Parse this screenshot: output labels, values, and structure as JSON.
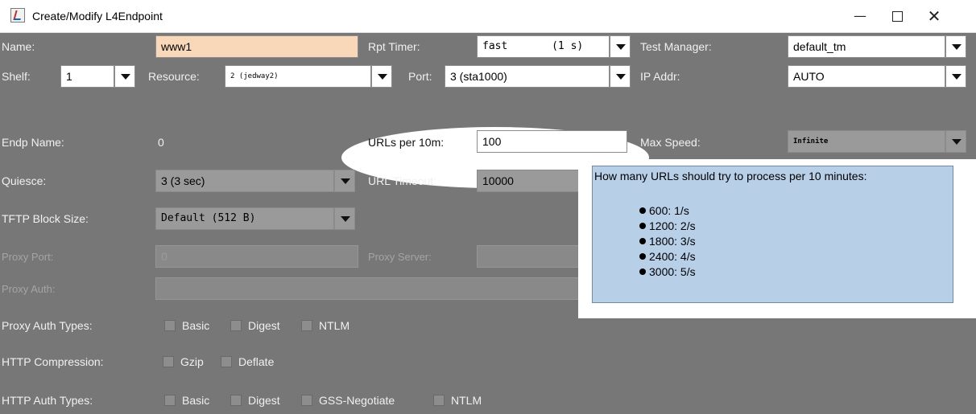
{
  "window": {
    "title": "Create/Modify L4Endpoint",
    "minimize": "—",
    "close": "✕"
  },
  "form": {
    "name": {
      "label": "Name:",
      "value": "www1"
    },
    "rpt_timer": {
      "label": "Rpt Timer:",
      "value": "fast       (1 s)"
    },
    "test_manager": {
      "label": "Test Manager:",
      "value": "default_tm"
    },
    "shelf": {
      "label": "Shelf:",
      "value": "1"
    },
    "resource": {
      "label": "Resource:",
      "value": "2 (jedway2)"
    },
    "port": {
      "label": "Port:",
      "value": "3 (sta1000)"
    },
    "ip_addr": {
      "label": "IP Addr:",
      "value": "AUTO"
    },
    "endp_name": {
      "label": "Endp Name:",
      "value": "0"
    },
    "urls_per_10m": {
      "label": "URLs per 10m:",
      "value": "100"
    },
    "max_speed": {
      "label": "Max Speed:",
      "value": "Infinite"
    },
    "quiesce": {
      "label": "Quiesce:",
      "value": "3 (3 sec)"
    },
    "url_timeout": {
      "label": "URL Timeout:",
      "value": "10000"
    },
    "tftp_block_size": {
      "label": "TFTP Block Size:",
      "value": "Default (512 B)"
    },
    "proxy_port": {
      "label": "Proxy Port:",
      "value": "0"
    },
    "proxy_server": {
      "label": "Proxy Server:",
      "value": ""
    },
    "proxy_auth": {
      "label": "Proxy Auth:",
      "value": ""
    },
    "proxy_auth_types": {
      "label": "Proxy Auth Types:",
      "options": [
        "Basic",
        "Digest",
        "NTLM"
      ]
    },
    "http_compression": {
      "label": "HTTP Compression:",
      "options": [
        "Gzip",
        "Deflate"
      ]
    },
    "http_auth_types": {
      "label": "HTTP Auth Types:",
      "options": [
        "Basic",
        "Digest",
        "GSS-Negotiate",
        "NTLM"
      ]
    }
  },
  "tooltip": {
    "title": "How many URLs should try to process per 10 minutes:",
    "items": [
      "600: 1/s",
      "1200: 2/s",
      "1800: 3/s",
      "2400: 4/s",
      "3000: 5/s"
    ]
  },
  "colors": {
    "overlay": "#777777",
    "tooltip_bg": "#b8cfe8",
    "name_field": "#f8d8b8"
  }
}
